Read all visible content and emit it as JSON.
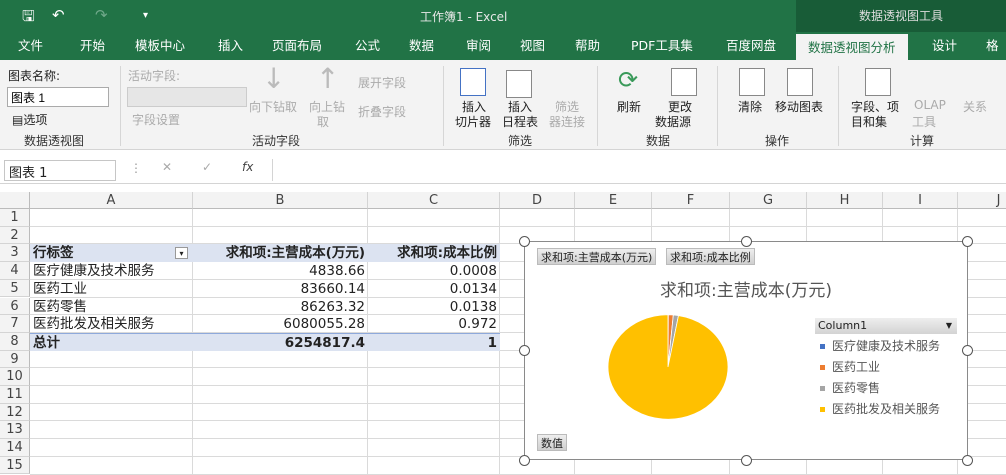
{
  "window": {
    "title": "工作簿1  -  Excel",
    "context_tab": "数据透视图工具"
  },
  "tabs": [
    "文件",
    "开始",
    "模板中心",
    "插入",
    "页面布局",
    "公式",
    "数据",
    "审阅",
    "视图",
    "帮助",
    "PDF工具集",
    "百度网盘",
    "数据透视图分析",
    "设计",
    "格式"
  ],
  "ribbon": {
    "chart_name_label": "图表名称:",
    "chart_name_value": "图表 1",
    "options": "选项",
    "group_pivot": "数据透视图",
    "active_field_label": "活动字段:",
    "field_settings": "字段设置",
    "drill_down": "向下钻取",
    "drill_up": "向上钻",
    "drill_up2": "取",
    "expand": "展开字段",
    "collapse": "折叠字段",
    "group_active": "活动字段",
    "insert_slicer": [
      "插入",
      "切片器"
    ],
    "insert_timeline": [
      "插入",
      "日程表"
    ],
    "filter_conn": [
      "筛选",
      "器连接"
    ],
    "group_filter": "筛选",
    "refresh": "刷新",
    "change_source": [
      "更改",
      "数据源"
    ],
    "group_data": "数据",
    "clear": "清除",
    "move_chart": "移动图表",
    "group_actions": "操作",
    "fields_items": [
      "字段、项",
      "目和集"
    ],
    "olap": [
      "OLAP",
      "工具"
    ],
    "relations": "关系",
    "group_calc": "计算"
  },
  "formula_bar": {
    "name_box": "图表 1",
    "fx": "fx",
    "formula": ""
  },
  "columns": [
    "A",
    "B",
    "C",
    "D",
    "E",
    "F",
    "G",
    "H",
    "I",
    "J"
  ],
  "rows": [
    "1",
    "2",
    "3",
    "4",
    "5",
    "6",
    "7",
    "8",
    "9",
    "10",
    "11",
    "12",
    "13",
    "14",
    "15"
  ],
  "pivot": {
    "headers": [
      "行标签",
      "求和项:主营成本(万元)",
      "求和项:成本比例"
    ],
    "data": [
      [
        "医疗健康及技术服务",
        "4838.66",
        "0.0008"
      ],
      [
        "医药工业",
        "83660.14",
        "0.0134"
      ],
      [
        "医药零售",
        "86263.32",
        "0.0138"
      ],
      [
        "医药批发及相关服务",
        "6080055.28",
        "0.972"
      ]
    ],
    "total": [
      "总计",
      "6254817.4",
      "1"
    ]
  },
  "chart_data": {
    "type": "pie",
    "title": "求和项:主营成本(万元)",
    "field_buttons": [
      "求和项:主营成本(万元)",
      "求和项:成本比例"
    ],
    "value_button": "数值",
    "legend_title": "Column1",
    "categories": [
      "医疗健康及技术服务",
      "医药工业",
      "医药零售",
      "医药批发及相关服务"
    ],
    "values": [
      4838.66,
      83660.14,
      86263.32,
      6080055.28
    ],
    "colors": [
      "#4472c4",
      "#ed7d31",
      "#a5a5a5",
      "#ffc000"
    ],
    "legend": "right"
  }
}
